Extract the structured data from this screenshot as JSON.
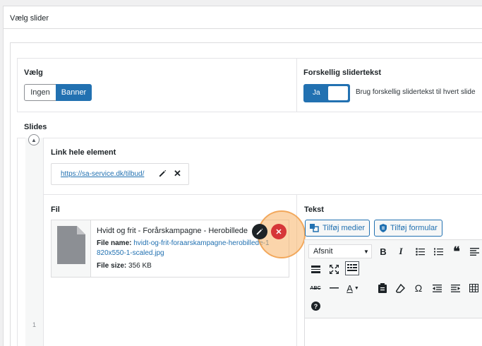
{
  "panel": {
    "title": "Vælg slider"
  },
  "settings": {
    "choose_label": "Vælg",
    "options": [
      "Ingen",
      "Banner"
    ],
    "selected": "Banner",
    "different_text_label": "Forskellig slidertekst",
    "toggle_value": "Ja",
    "toggle_desc": "Brug forskellig slidertekst til hvert slide"
  },
  "slides": {
    "label": "Slides",
    "slide_number": "1",
    "link_label": "Link hele element",
    "link_url": "https://sa-service.dk/tilbud/",
    "file_label": "Fil",
    "file_title": "Hvidt og frit - Forårskampagne - Herobillede",
    "file_name_label": "File name:",
    "file_name_part1": "hvidt-og-frit-foraarskampagne-herobillede-1",
    "file_name_part2": "820x550-1-scaled.jpg",
    "file_size_label": "File size:",
    "file_size_value": "356 KB",
    "text_label": "Tekst",
    "add_media": "Tilføj medier",
    "add_form": "Tilføj formular",
    "format_value": "Afsnit"
  },
  "icons": {
    "edit": "pencil-icon",
    "close": "close-icon",
    "delete": "delete-icon",
    "file": "file-icon"
  }
}
